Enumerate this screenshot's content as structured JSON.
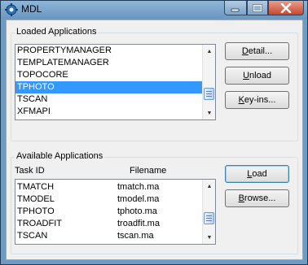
{
  "window": {
    "title": "MDL",
    "title_icon": "mdl-gear-icon",
    "controls": {
      "minimize_icon": "minimize-icon",
      "maximize_icon": "maximize-icon",
      "close_icon": "close-icon"
    }
  },
  "loaded": {
    "group_title": "Loaded Applications",
    "items": [
      "PROPERTYMANAGER",
      "TEMPLATEMANAGER",
      "TOPOCORE",
      "TPHOTO",
      "TSCAN",
      "XFMAPI"
    ],
    "selected": "TPHOTO",
    "buttons": {
      "detail": {
        "mnemonic": "D",
        "rest": "etail..."
      },
      "unload": {
        "mnemonic": "U",
        "rest": "nload"
      },
      "keyins": {
        "mnemonic": "K",
        "rest": "ey-ins..."
      }
    }
  },
  "available": {
    "group_title": "Available Applications",
    "columns": [
      "Task ID",
      "Filename"
    ],
    "rows": [
      {
        "task": "TMATCH",
        "file": "tmatch.ma"
      },
      {
        "task": "TMODEL",
        "file": "tmodel.ma"
      },
      {
        "task": "TPHOTO",
        "file": "tphoto.ma"
      },
      {
        "task": "TROADFIT",
        "file": "troadfit.ma"
      },
      {
        "task": "TSCAN",
        "file": "tscan.ma"
      }
    ],
    "buttons": {
      "load": {
        "mnemonic": "L",
        "rest": "oad"
      },
      "browse": {
        "mnemonic": "B",
        "rest": "rowse..."
      }
    }
  },
  "colors": {
    "selection": "#3399ff",
    "titlebar": "#6f9bc2",
    "close_button": "#c7452c",
    "dialog_face": "#f0f0f0"
  }
}
